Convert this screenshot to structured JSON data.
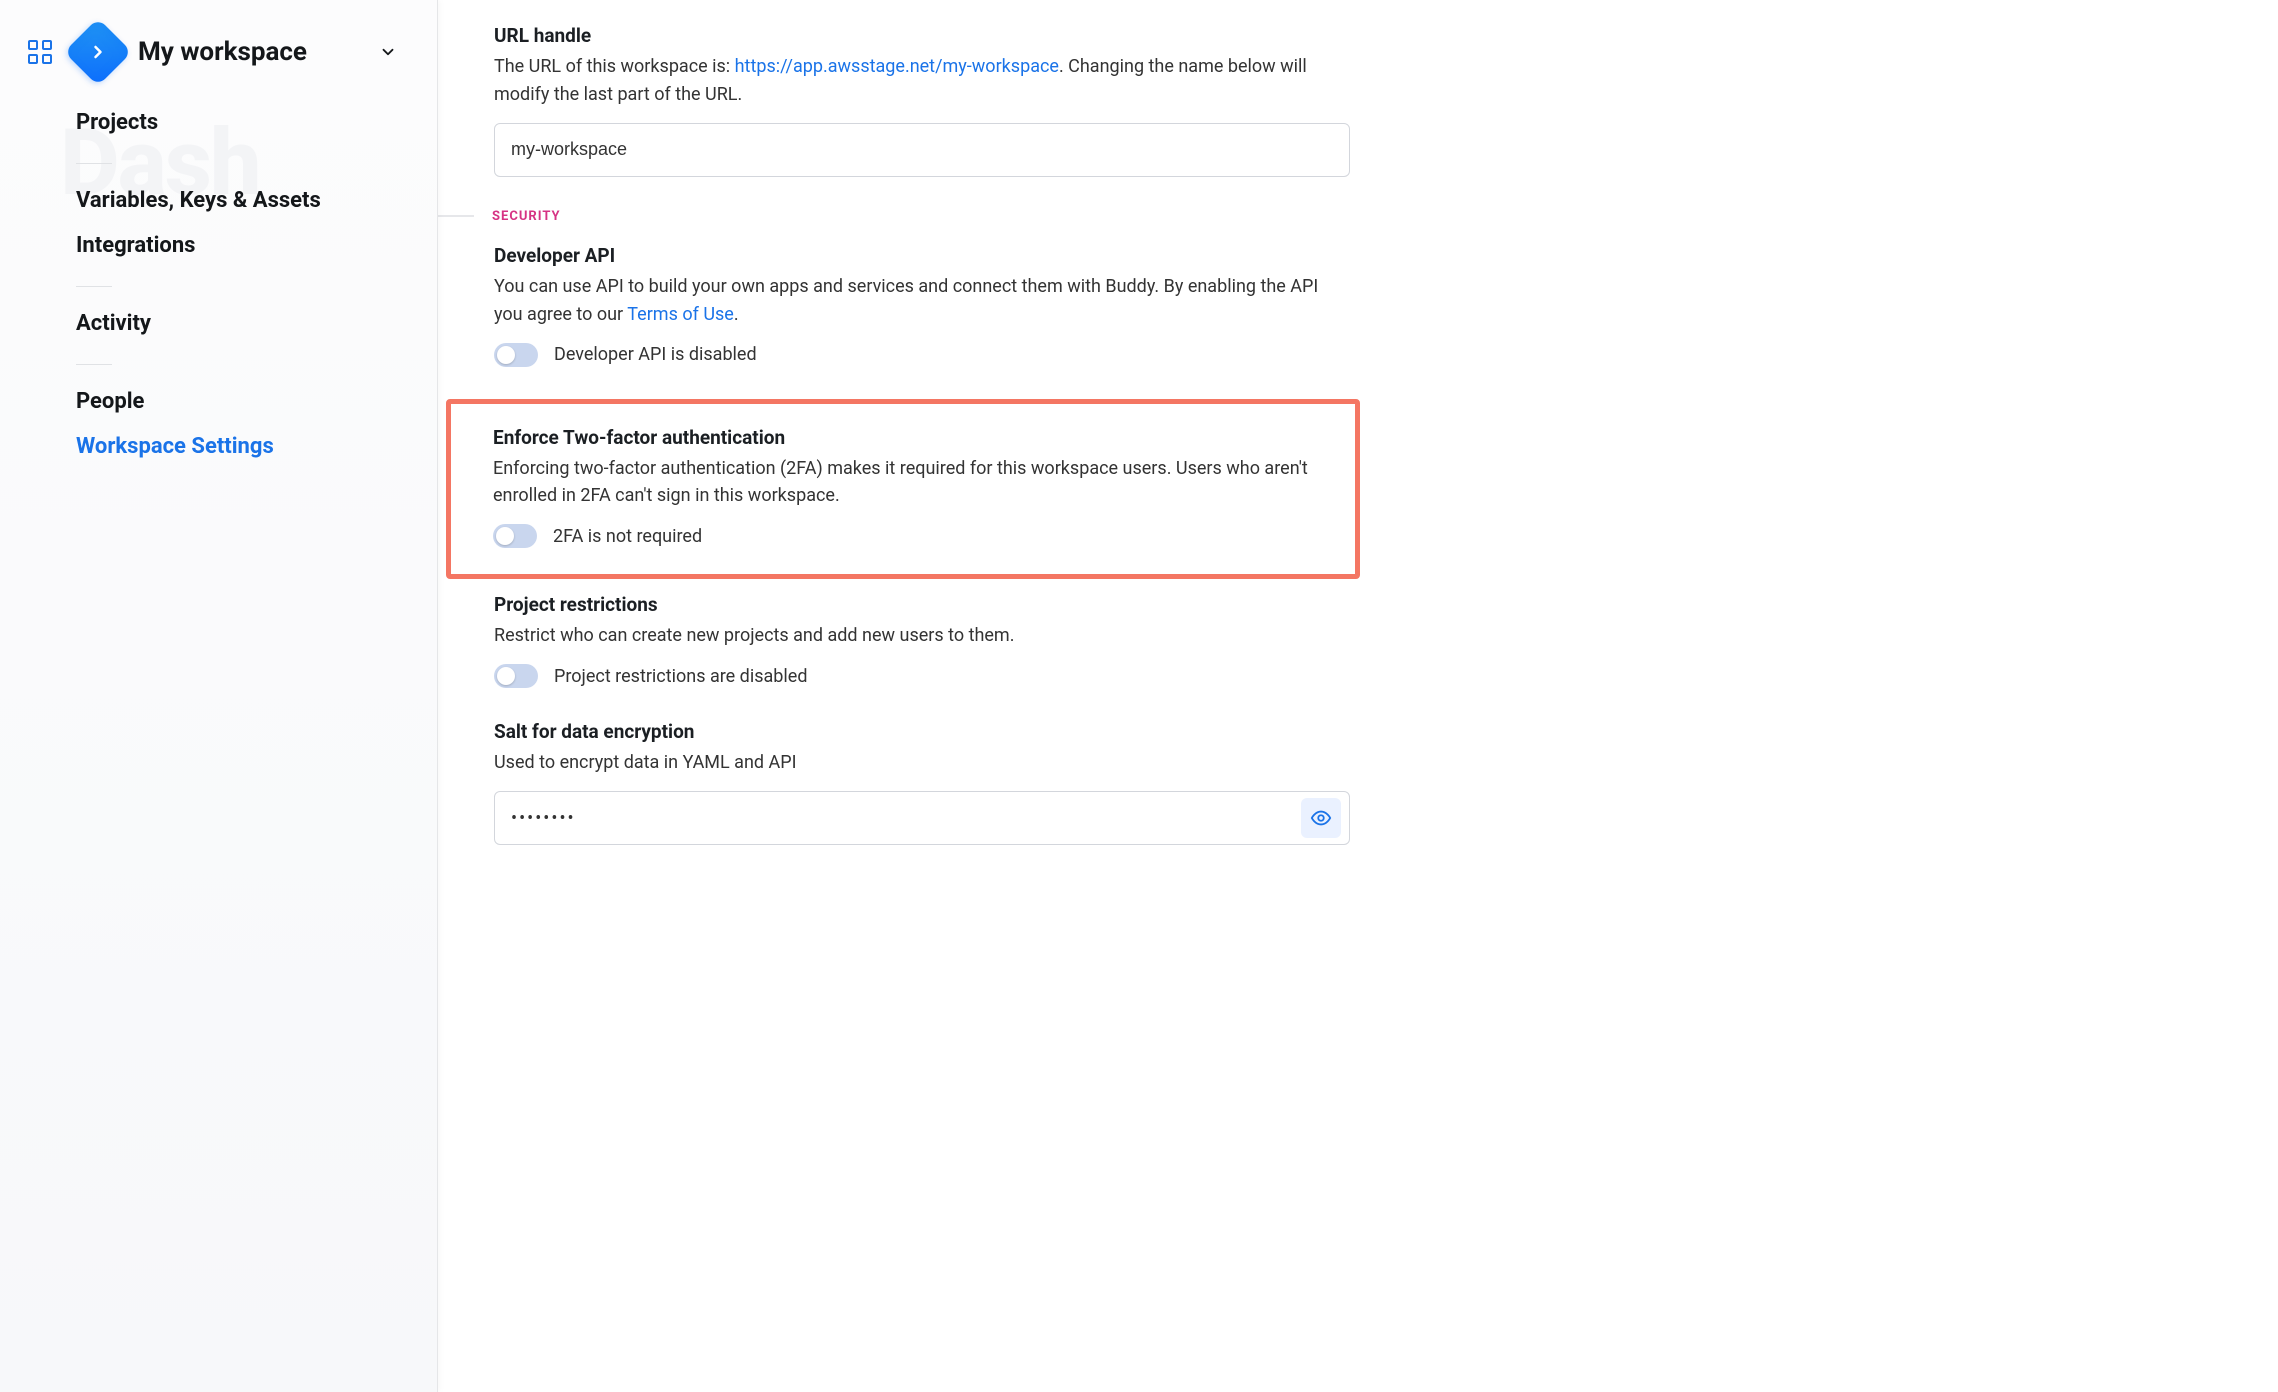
{
  "sidebar": {
    "workspace_name": "My workspace",
    "watermark": "Dash",
    "nav": {
      "projects": "Projects",
      "variables": "Variables, Keys & Assets",
      "integrations": "Integrations",
      "activity": "Activity",
      "people": "People",
      "workspace_settings": "Workspace Settings"
    }
  },
  "settings": {
    "url_handle": {
      "title": "URL handle",
      "desc_prefix": "The URL of this workspace is: ",
      "url": "https://app.awsstage.net/my-workspace",
      "desc_suffix": ". Changing the name below will modify the last part of the URL.",
      "value": "my-workspace"
    },
    "security_header": "SECURITY",
    "dev_api": {
      "title": "Developer API",
      "desc_prefix": "You can use API to build your own apps and services and connect them with Buddy. By enabling the API you agree to our ",
      "terms_link": "Terms of Use",
      "desc_suffix": ".",
      "toggle_label": "Developer API is disabled"
    },
    "two_fa": {
      "title": "Enforce Two-factor authentication",
      "desc": "Enforcing two-factor authentication (2FA) makes it required for this workspace users. Users who aren't enrolled in 2FA can't sign in this workspace.",
      "toggle_label": "2FA is not required"
    },
    "project_restrictions": {
      "title": "Project restrictions",
      "desc": "Restrict who can create new projects and add new users to them.",
      "toggle_label": "Project restrictions are disabled"
    },
    "salt": {
      "title": "Salt for data encryption",
      "desc": "Used to encrypt data in YAML and API",
      "masked": "••••••••"
    }
  }
}
